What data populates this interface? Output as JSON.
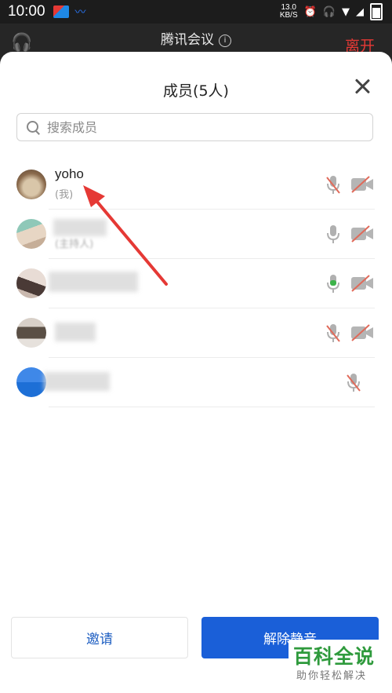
{
  "status_bar": {
    "time": "10:00",
    "net_speed_value": "13.0",
    "net_speed_unit": "KB/S"
  },
  "meeting": {
    "title": "腾讯会议",
    "leave_label": "离开",
    "info_icon": "info-icon",
    "audio_icon": "headset-icon"
  },
  "sheet": {
    "title": "成员(5人)",
    "search_placeholder": "搜索成员",
    "members": [
      {
        "name": "yoho",
        "sub": "(我)",
        "mic": "muted",
        "camera": "off"
      },
      {
        "name": "",
        "sub": "(主持人)",
        "mic": "idle",
        "camera": "off"
      },
      {
        "name": "",
        "sub": "",
        "mic": "active",
        "camera": "off"
      },
      {
        "name": "",
        "sub": "",
        "mic": "muted",
        "camera": "off"
      },
      {
        "name": "",
        "sub": "",
        "mic": "muted",
        "camera": ""
      }
    ],
    "invite_label": "邀请",
    "unmute_label": "解除静音"
  },
  "colors": {
    "accent": "#1a5fd8",
    "leave": "#e53935",
    "muted_slash": "#e06a5a",
    "mic_active": "#3db34a",
    "annotation_arrow": "#e53935"
  },
  "watermark": {
    "main": "百科全说",
    "sub": "助你轻松解决"
  }
}
